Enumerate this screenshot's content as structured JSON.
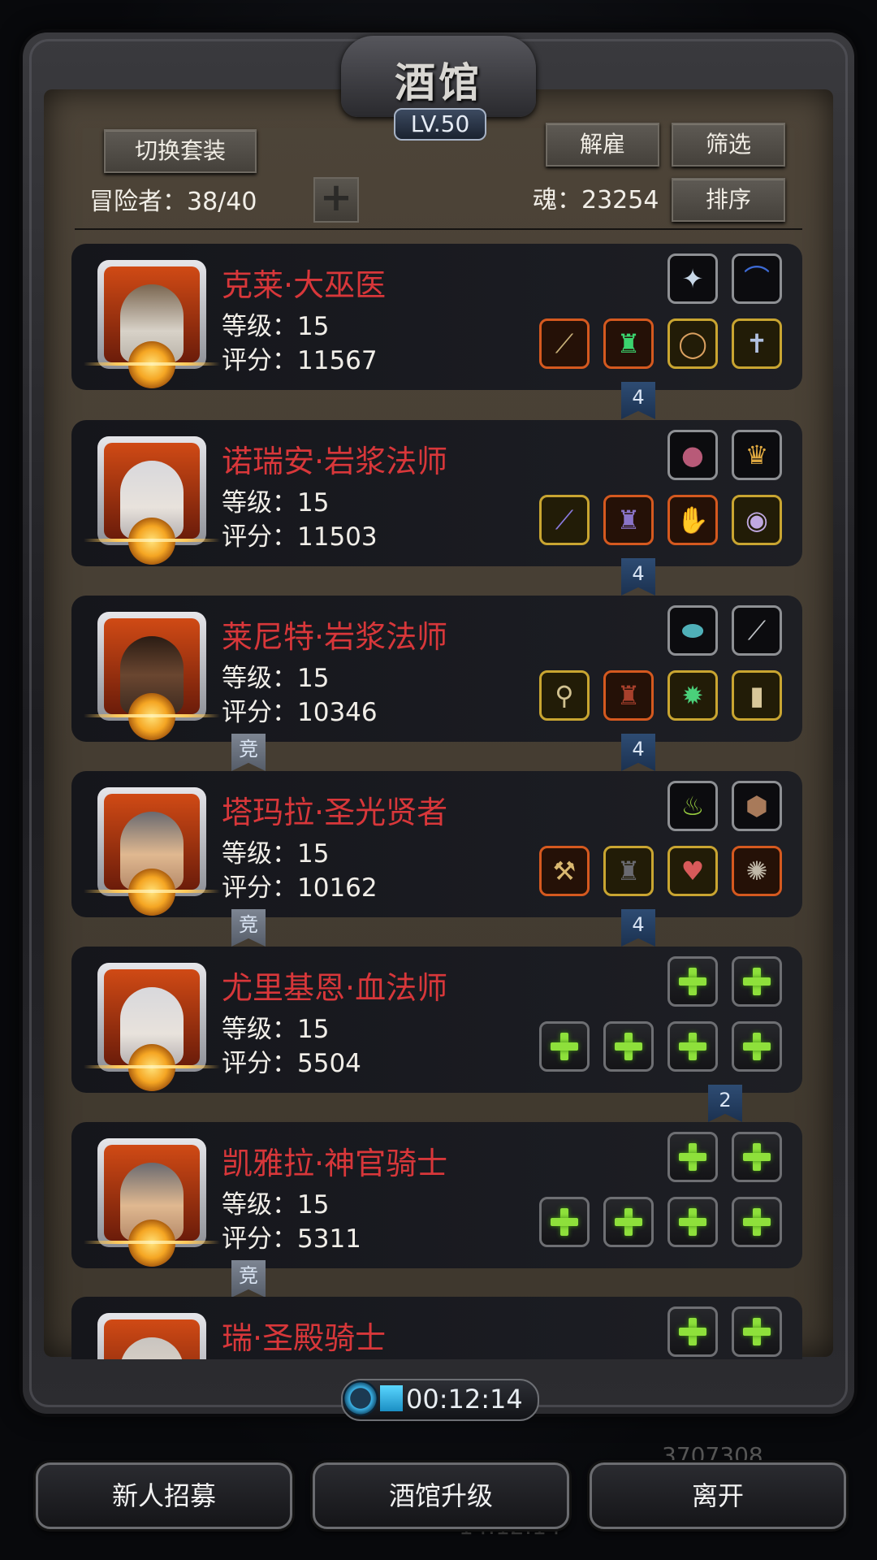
{
  "header": {
    "title": "酒馆",
    "level": "LV.50"
  },
  "toolbar": {
    "switch_outfit": "切换套装",
    "dismiss": "解雇",
    "filter": "筛选",
    "sort": "排序",
    "adventurers_text": "冒险者：38/40",
    "soul_text": "魂：23254",
    "add_symbol": "+"
  },
  "heroes": [
    {
      "name": "克莱·大巫医",
      "level": "等级：15",
      "score": "评分：11567",
      "count_tag": "4",
      "tag": ""
    },
    {
      "name": "诺瑞安·岩浆法师",
      "level": "等级：15",
      "score": "评分：11503",
      "count_tag": "4",
      "tag": ""
    },
    {
      "name": "莱尼特·岩浆法师",
      "level": "等级：15",
      "score": "评分：10346",
      "count_tag": "4",
      "tag": "竞"
    },
    {
      "name": "塔玛拉·圣光贤者",
      "level": "等级：15",
      "score": "评分：10162",
      "count_tag": "4",
      "tag": "竞"
    },
    {
      "name": "尤里基恩·血法师",
      "level": "等级：15",
      "score": "评分：5504",
      "count_tag": "2",
      "tag": ""
    },
    {
      "name": "凯雅拉·神官骑士",
      "level": "等级：15",
      "score": "评分：5311",
      "count_tag": "",
      "tag": "竞"
    },
    {
      "name": "瑞·圣殿骑士",
      "level": "",
      "score": "",
      "count_tag": "",
      "tag": ""
    }
  ],
  "timer": "00:12:14",
  "bottom": {
    "recruit": "新人招募",
    "upgrade": "酒馆升级",
    "leave": "离开"
  },
  "background_text": {
    "gold": "3707308",
    "clock": "14:12:14"
  },
  "colors": {
    "hero_name": "#d8373a",
    "panel": "#4d4438",
    "accent_green": "#8ee03b",
    "tag_blue": "#2e4c73"
  }
}
